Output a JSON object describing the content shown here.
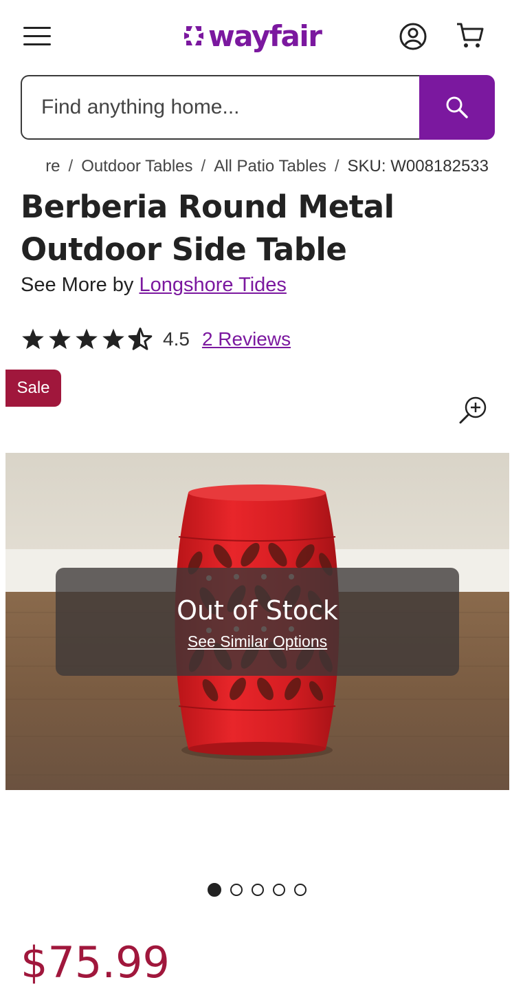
{
  "header": {
    "logo_text": "wayfair",
    "brand_color": "#7b189f",
    "icons": [
      "hamburger-menu-icon",
      "account-icon",
      "cart-icon"
    ]
  },
  "search": {
    "placeholder": "Find anything home...",
    "value": ""
  },
  "breadcrumb": {
    "items": [
      "re",
      "Outdoor Tables",
      "All Patio Tables"
    ],
    "sku": "SKU: W008182533"
  },
  "product": {
    "title": "Berberia Round Metal Outdoor Side Table",
    "see_more_prefix": "See More by",
    "brand": "Longshore Tides",
    "rating": "4.5",
    "rating_value": 4.5,
    "reviews": "2 Reviews",
    "sale_badge": "Sale",
    "sale_color": "#a0173c",
    "stock_status": "Out of Stock",
    "stock_link": "See Similar Options",
    "price": "$75.99",
    "gallery_images": 5,
    "gallery_active_index": 0
  }
}
